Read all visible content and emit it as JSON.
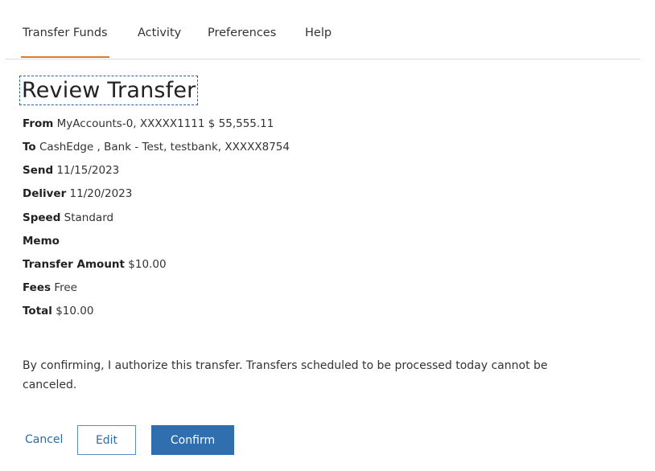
{
  "nav": {
    "tabs": [
      {
        "label": "Transfer Funds",
        "active": true
      },
      {
        "label": "Activity"
      },
      {
        "label": "Preferences"
      },
      {
        "label": "Help"
      }
    ],
    "active_color": "#e0782b"
  },
  "review": {
    "title": "Review Transfer",
    "fields": {
      "from": {
        "label": "From",
        "value": "MyAccounts-0, XXXXX1111 $ 55,555.11"
      },
      "to": {
        "label": "To",
        "value": "CashEdge , Bank - Test, testbank, XXXXX8754"
      },
      "send": {
        "label": "Send",
        "value": "11/15/2023"
      },
      "deliver": {
        "label": "Deliver",
        "value": "11/20/2023"
      },
      "speed": {
        "label": "Speed",
        "value": "Standard"
      },
      "memo": {
        "label": "Memo",
        "value": ""
      },
      "amount": {
        "label": "Transfer Amount",
        "value": "$10.00"
      },
      "fees": {
        "label": "Fees",
        "value": "Free"
      },
      "total": {
        "label": "Total",
        "value": "$10.00"
      }
    },
    "notice": "By confirming, I authorize this transfer. Transfers scheduled to be processed today cannot be canceled."
  },
  "actions": {
    "cancel_label": "Cancel",
    "edit_label": "Edit",
    "confirm_label": "Confirm",
    "primary_color": "#2f6eaf"
  }
}
